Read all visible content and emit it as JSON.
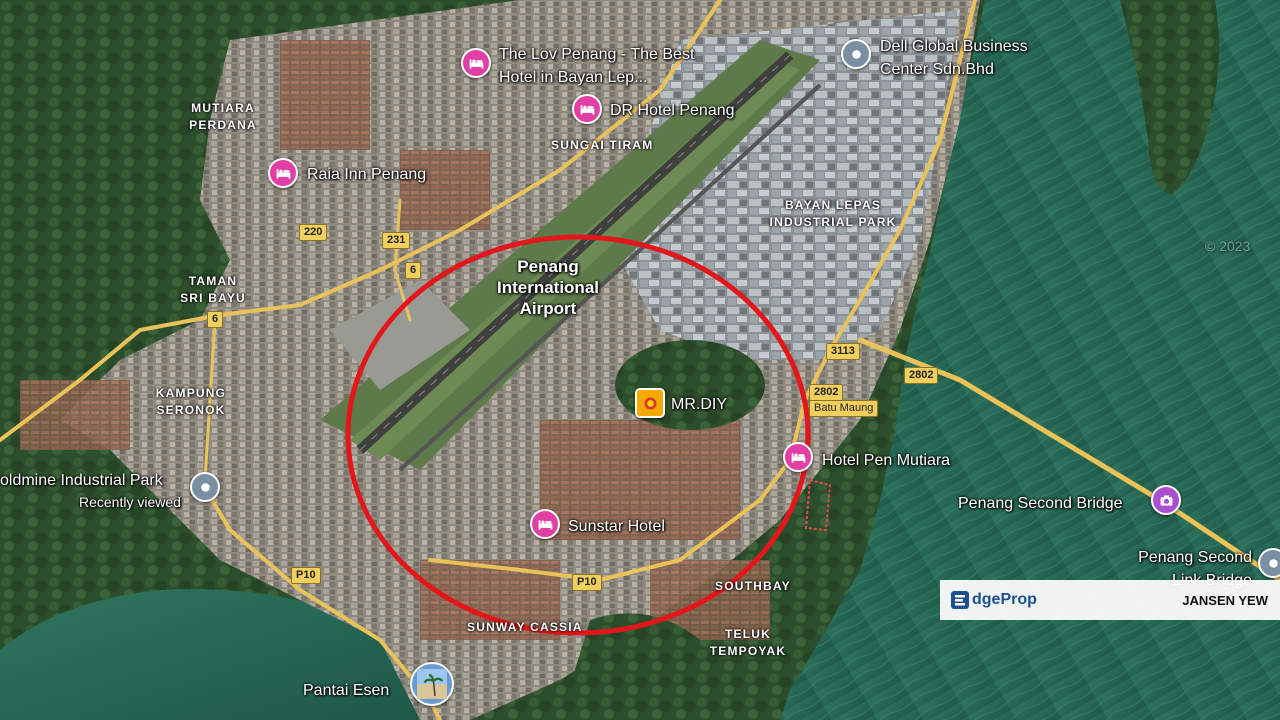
{
  "places": {
    "lov_penang": "The Lov Penang - The Best Hotel in Bayan Lep...",
    "dell": "Dell Global Business Center Sdn.Bhd",
    "dr_hotel": "DR Hotel Penang",
    "raia_inn": "Raia Inn Penang",
    "mrdiy": "MR.DIY",
    "pen_mutiara": "Hotel Pen Mutiara",
    "second_bridge": "Penang Second Bridge",
    "second_link_bridge": "Penang Second Link Bridge",
    "sunstar": "Sunstar Hotel",
    "goldmine": "oldmine Industrial Park",
    "goldmine_sub": "Recently viewed",
    "pantai_esen": "Pantai Esen"
  },
  "areas": {
    "mutiara_perdana": "MUTIARA PERDANA",
    "sungai_tiram": "SUNGAI TIRAM",
    "bayan_lepas": "BAYAN LEPAS INDUSTRIAL PARK",
    "taman_sri_bayu": "TAMAN SRI BAYU",
    "kampung_seronok": "KAMPUNG SERONOK",
    "southbay": "SOUTHBAY",
    "sunway_cassia": "SUNWAY CASSIA",
    "teluk_tempoyak": "TELUK TEMPOYAK",
    "airport": "Penang International Airport"
  },
  "roads": {
    "r220": "220",
    "r231": "231",
    "r6a": "6",
    "r6b": "6",
    "r3113": "3113",
    "r2802a": "2802",
    "r2802b": "2802",
    "batu_maung": "Batu Maung",
    "p10a": "P10",
    "p10b": "P10"
  },
  "watermark": {
    "brand": "dgeProp",
    "author": "JANSEN YEW",
    "copyright": "© 2023"
  },
  "colors": {
    "highlight_circle": "#e3161b",
    "hotel_pin": "#e23fa5",
    "business_pin": "#7b8fa3",
    "bridge_pin": "#a94fd0",
    "store_pin": "#f2a900",
    "road": "#f1cf5f",
    "sea": "#2b6a57"
  },
  "icons": {
    "hotel": "bed-icon",
    "business": "location-dot-icon",
    "store": "store-icon",
    "bridge": "camera-icon",
    "beach": "beach-photo-icon"
  }
}
